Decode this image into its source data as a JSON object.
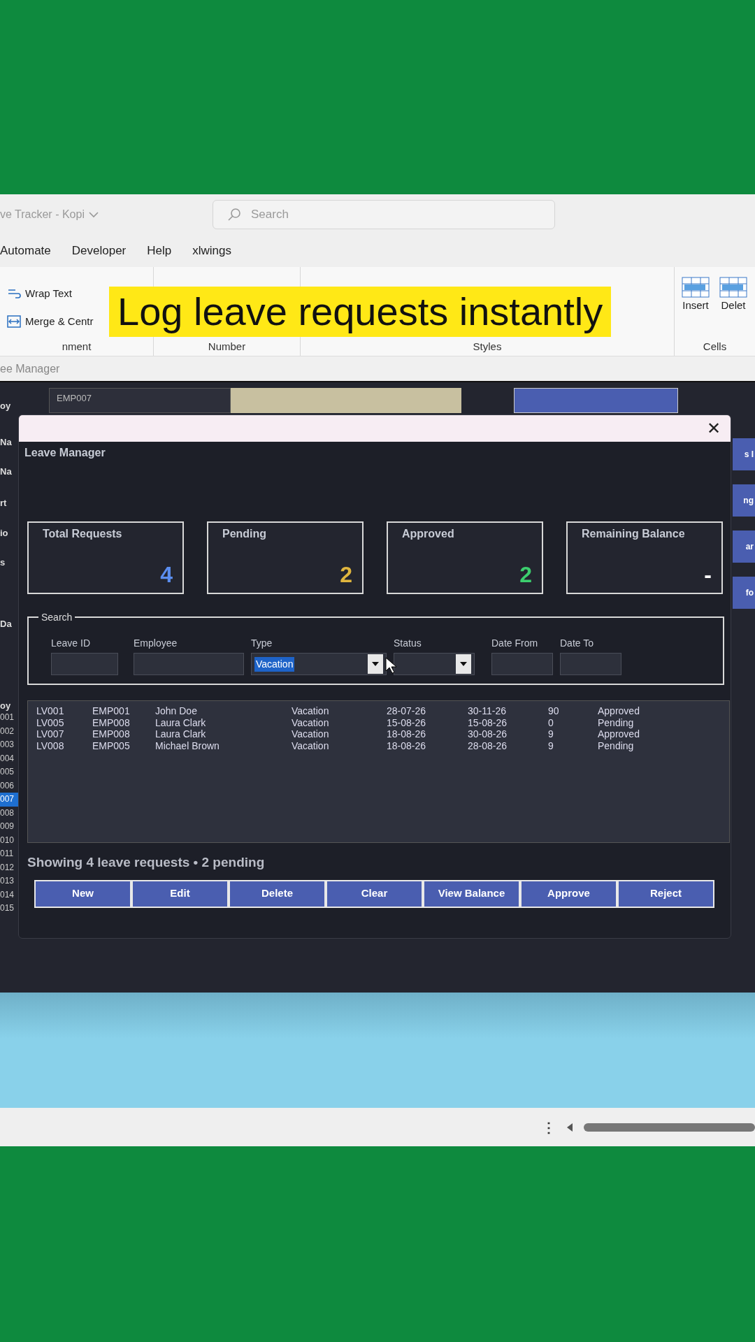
{
  "excel": {
    "title": "ve Tracker - Kopi",
    "search": {
      "placeholder": "Search"
    },
    "menu": [
      "Automate",
      "Developer",
      "Help",
      "xlwings"
    ],
    "ribbon": {
      "alignment_buttons": [
        "Wrap Text",
        "Merge & Centr"
      ],
      "groups": [
        "nment",
        "Number",
        "Styles",
        "Cells"
      ],
      "cells_buttons": [
        "Insert",
        "Delet"
      ]
    },
    "sheet_tab": "ee Manager"
  },
  "caption": "Log leave requests instantly",
  "sheet": {
    "labels": [
      "oy",
      "Na",
      "Na",
      "rt",
      "io",
      "s",
      "Da",
      "oy"
    ],
    "employee_id": "EMP007",
    "ids": [
      {
        "text": "001",
        "selected": false
      },
      {
        "text": "002",
        "selected": false
      },
      {
        "text": "003",
        "selected": false
      },
      {
        "text": "004",
        "selected": false
      },
      {
        "text": "005",
        "selected": false
      },
      {
        "text": "006",
        "selected": false
      },
      {
        "text": "007",
        "selected": true
      },
      {
        "text": "008",
        "selected": false
      },
      {
        "text": "009",
        "selected": false
      },
      {
        "text": "010",
        "selected": false
      },
      {
        "text": "011",
        "selected": false
      },
      {
        "text": "012",
        "selected": false
      },
      {
        "text": "013",
        "selected": false
      },
      {
        "text": "014",
        "selected": false
      },
      {
        "text": "015",
        "selected": false
      }
    ],
    "side_buttons": [
      "s I",
      "ng",
      "ar",
      "fo"
    ]
  },
  "status_bar": {
    "more_glyph": "⋮"
  },
  "form": {
    "title": "Leave Manager",
    "close_glyph": "✕",
    "stats": [
      {
        "label": "Total Requests",
        "value": "4",
        "color": "#5b8ef0"
      },
      {
        "label": "Pending",
        "value": "2",
        "color": "#e0b63e"
      },
      {
        "label": "Approved",
        "value": "2",
        "color": "#3ccf6e"
      },
      {
        "label": "Remaining Balance",
        "value": "-",
        "color": "#ffffff"
      }
    ],
    "search": {
      "title": "Search",
      "fields": [
        {
          "label": "Leave ID",
          "kind": "text"
        },
        {
          "label": "Employee",
          "kind": "text"
        },
        {
          "label": "Type",
          "kind": "select",
          "value": "Vacation"
        },
        {
          "label": "Status",
          "kind": "select"
        },
        {
          "label": "Date From",
          "kind": "text"
        },
        {
          "label": "Date To",
          "kind": "text"
        }
      ]
    },
    "rows": [
      [
        "LV001",
        "EMP001",
        "John Doe",
        "Vacation",
        "28-07-26",
        "30-11-26",
        "90",
        "Approved"
      ],
      [
        "LV005",
        "EMP008",
        "Laura Clark",
        "Vacation",
        "15-08-26",
        "15-08-26",
        "0",
        "Pending"
      ],
      [
        "LV007",
        "EMP008",
        "Laura Clark",
        "Vacation",
        "18-08-26",
        "30-08-26",
        "9",
        "Approved"
      ],
      [
        "LV008",
        "EMP005",
        "Michael Brown",
        "Vacation",
        "18-08-26",
        "28-08-26",
        "9",
        "Pending"
      ]
    ],
    "status": "Showing 4 leave requests  •  2 pending",
    "buttons": [
      "New",
      "Edit",
      "Delete",
      "Clear",
      "View Balance",
      "Approve",
      "Reject"
    ]
  }
}
